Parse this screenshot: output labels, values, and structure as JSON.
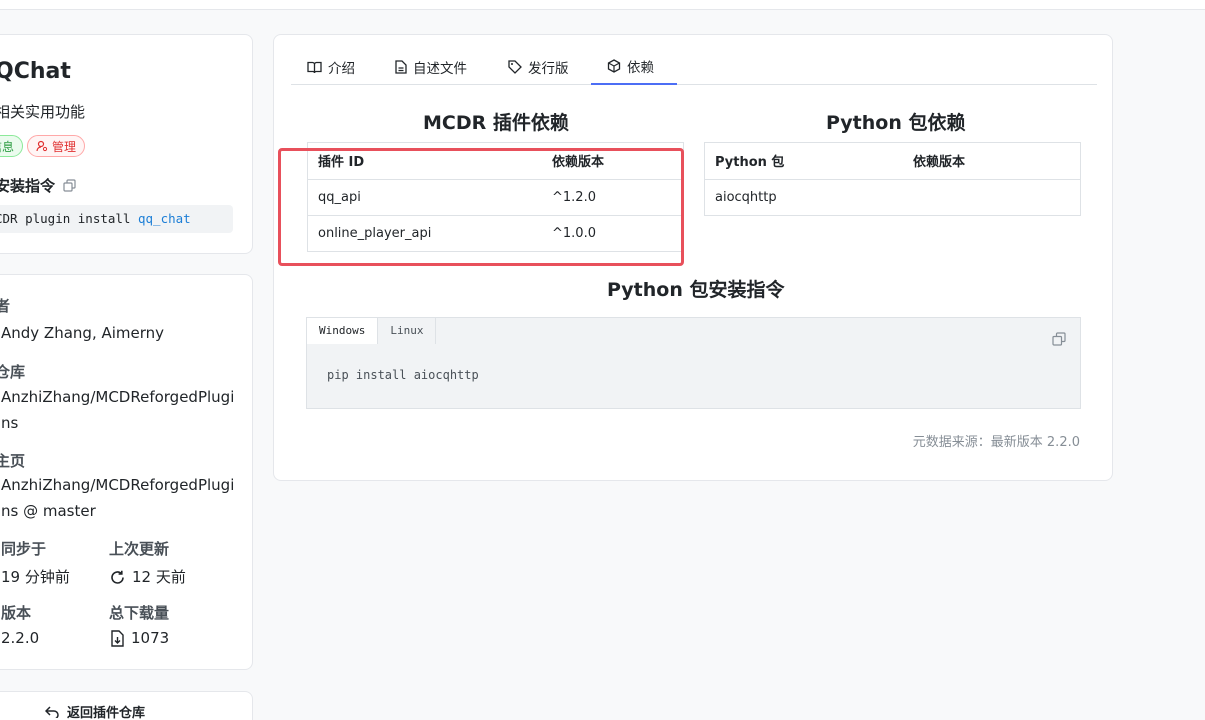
{
  "plugin": {
    "title": "QChat",
    "description": "相关实用功能",
    "tags": [
      {
        "label": "信息",
        "icon": "info-icon"
      },
      {
        "label": "管理",
        "icon": "user-admin-icon"
      }
    ],
    "install_label": "安装指令",
    "install_cmd_prefix": "CDR plugin install ",
    "install_cmd_id": "qq_chat"
  },
  "meta": {
    "authors_label": "者",
    "authors_value": "Andy Zhang, Aimerny",
    "repo_label": "仓库",
    "repo_value_line1": "AnzhiZhang/MCDReforgedPlugi",
    "repo_value_line2": "ns",
    "homepage_label": "主页",
    "homepage_value_line1": "AnzhiZhang/MCDReforgedPlugi",
    "homepage_value_line2": "ns @ master",
    "synced_label": "同步于",
    "synced_value": "19 分钟前",
    "updated_label": "上次更新",
    "updated_value": "12 天前",
    "version_label": "版本",
    "version_value": "2.2.0",
    "downloads_label": "总下载量",
    "downloads_value": "1073"
  },
  "back_label": "返回插件仓库",
  "tabs": [
    {
      "label": "介绍",
      "icon": "book-icon"
    },
    {
      "label": "自述文件",
      "icon": "file-icon"
    },
    {
      "label": "发行版",
      "icon": "tag-icon"
    },
    {
      "label": "依赖",
      "icon": "package-icon"
    }
  ],
  "mcdr_deps": {
    "title": "MCDR 插件依赖",
    "headers": [
      "插件 ID",
      "依赖版本"
    ],
    "rows": [
      [
        "qq_api",
        "^1.2.0"
      ],
      [
        "online_player_api",
        "^1.0.0"
      ]
    ]
  },
  "py_deps": {
    "title": "Python 包依赖",
    "headers": [
      "Python 包",
      "依赖版本"
    ],
    "rows": [
      [
        "aiocqhttp",
        ""
      ]
    ]
  },
  "py_install": {
    "title": "Python 包安装指令",
    "os_tabs": [
      "Windows",
      "Linux"
    ],
    "command": "pip install aiocqhttp"
  },
  "source_note": "元数据来源：最新版本 2.2.0"
}
